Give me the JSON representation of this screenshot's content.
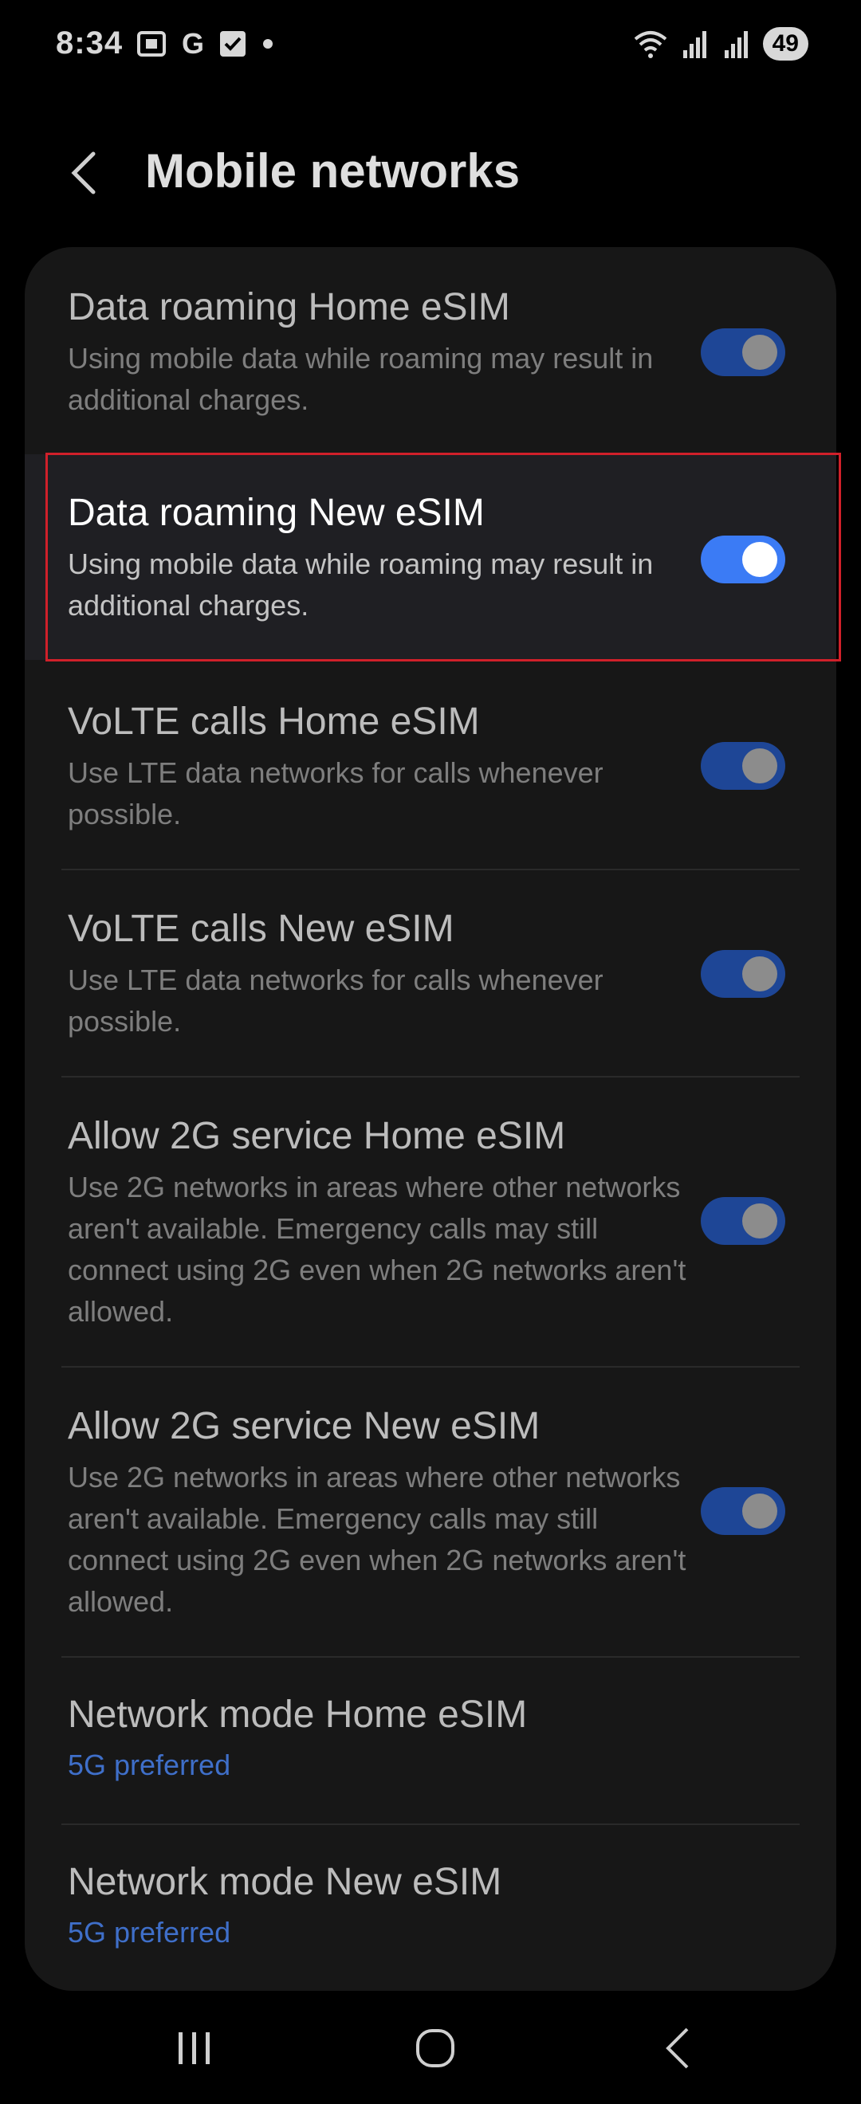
{
  "status_bar": {
    "time": "8:34",
    "left_icons": [
      "screenshot-icon",
      "google-icon",
      "checkbox-icon",
      "dot-icon"
    ],
    "google_glyph": "G",
    "battery": "49",
    "right_icons": [
      "wifi-icon",
      "signal-icon",
      "signal-icon"
    ]
  },
  "header": {
    "title": "Mobile networks"
  },
  "settings": [
    {
      "title": "Data roaming Home eSIM",
      "description": "Using mobile data while roaming may result in additional charges.",
      "toggle": true
    },
    {
      "title": "Data roaming New eSIM",
      "description": "Using mobile data while roaming may result in additional charges.",
      "toggle": true,
      "highlighted": true
    },
    {
      "title": "VoLTE calls Home eSIM",
      "description": "Use LTE data networks for calls whenever possible.",
      "toggle": true
    },
    {
      "title": "VoLTE calls New eSIM",
      "description": "Use LTE data networks for calls whenever possible.",
      "toggle": true
    },
    {
      "title": "Allow 2G service Home eSIM",
      "description": "Use 2G networks in areas where other networks aren't available. Emergency calls may still connect using 2G even when 2G networks aren't allowed.",
      "toggle": true
    },
    {
      "title": "Allow 2G service New eSIM",
      "description": "Use 2G networks in areas where other networks aren't available. Emergency calls may still connect using 2G even when 2G networks aren't allowed.",
      "toggle": true
    },
    {
      "title": "Network mode Home eSIM",
      "subtitle": "5G preferred"
    },
    {
      "title": "Network mode New eSIM",
      "subtitle": "5G preferred"
    }
  ],
  "colors": {
    "background": "#000000",
    "card": "#171717",
    "toggle_on": "#1e4696",
    "toggle_on_bright": "#3b7bf5",
    "link": "#3f6fc9",
    "highlight_border": "#d0202a"
  },
  "navbar": {
    "buttons": [
      "recents-icon",
      "home-icon",
      "back-icon"
    ]
  }
}
